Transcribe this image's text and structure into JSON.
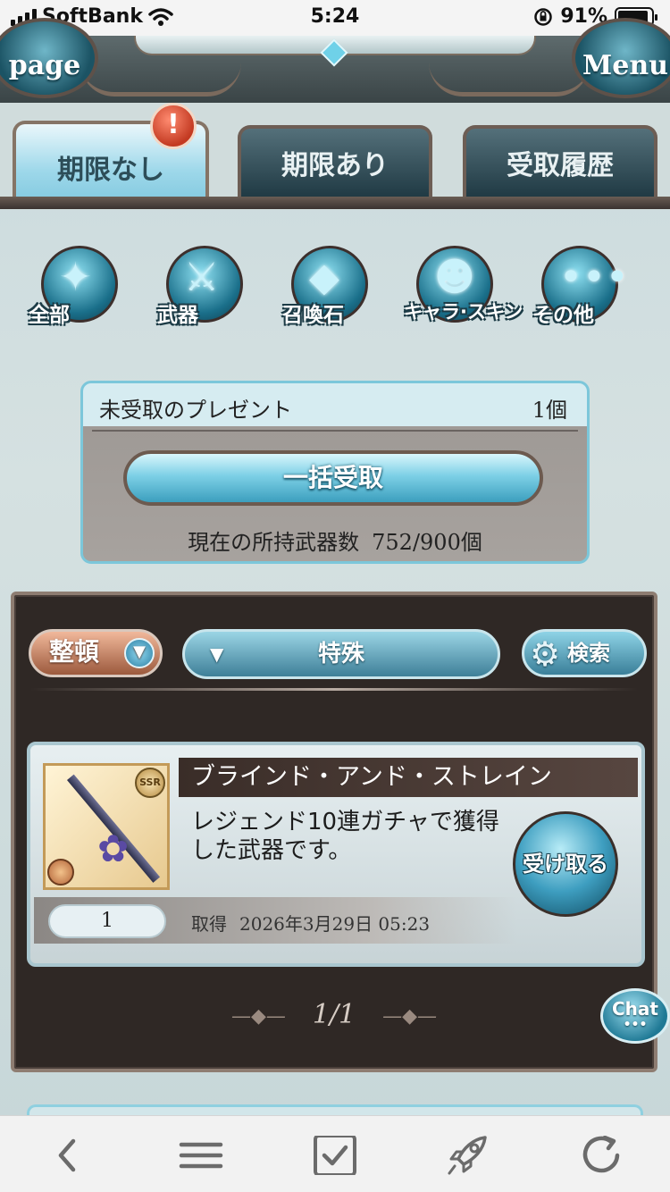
{
  "status_bar": {
    "carrier": "SoftBank",
    "time": "5:24",
    "battery_percent": "91%",
    "battery_level": 0.91
  },
  "header": {
    "left_button": "page",
    "right_button": "Menu"
  },
  "tabs": [
    {
      "label": "期限なし",
      "active": true,
      "badge": "!"
    },
    {
      "label": "期限あり",
      "active": false
    },
    {
      "label": "受取履歴",
      "active": false
    }
  ],
  "categories": [
    {
      "label": "全部",
      "icon": "all-icon"
    },
    {
      "label": "武器",
      "icon": "sword-icon"
    },
    {
      "label": "召喚石",
      "icon": "crystal-icon"
    },
    {
      "label": "キャラ·スキン",
      "icon": "character-icon"
    },
    {
      "label": "その他",
      "icon": "more-icon"
    }
  ],
  "unclaimed": {
    "title": "未受取のプレゼント",
    "count": "1個",
    "claim_all_label": "一括受取",
    "owned_label": "現在の所持武器数",
    "owned_value": "752/900個"
  },
  "controls": {
    "sort_label": "整頓",
    "filter_label": "特殊",
    "search_label": "検索"
  },
  "item": {
    "name": "ブラインド・アンド・ストレイン",
    "description": "レジェンド10連ガチャで獲得した武器です。",
    "rarity": "SSR",
    "quantity": "1",
    "acquired_label": "取得",
    "acquired_date": "2026年3月29日 05:23",
    "receive_label": "受け取る"
  },
  "pagination": "1/1",
  "chat_label": "Chat",
  "colors": {
    "accent": "#7dc6dd",
    "panel_dark": "#2f2825",
    "frame": "#8e7d72"
  }
}
